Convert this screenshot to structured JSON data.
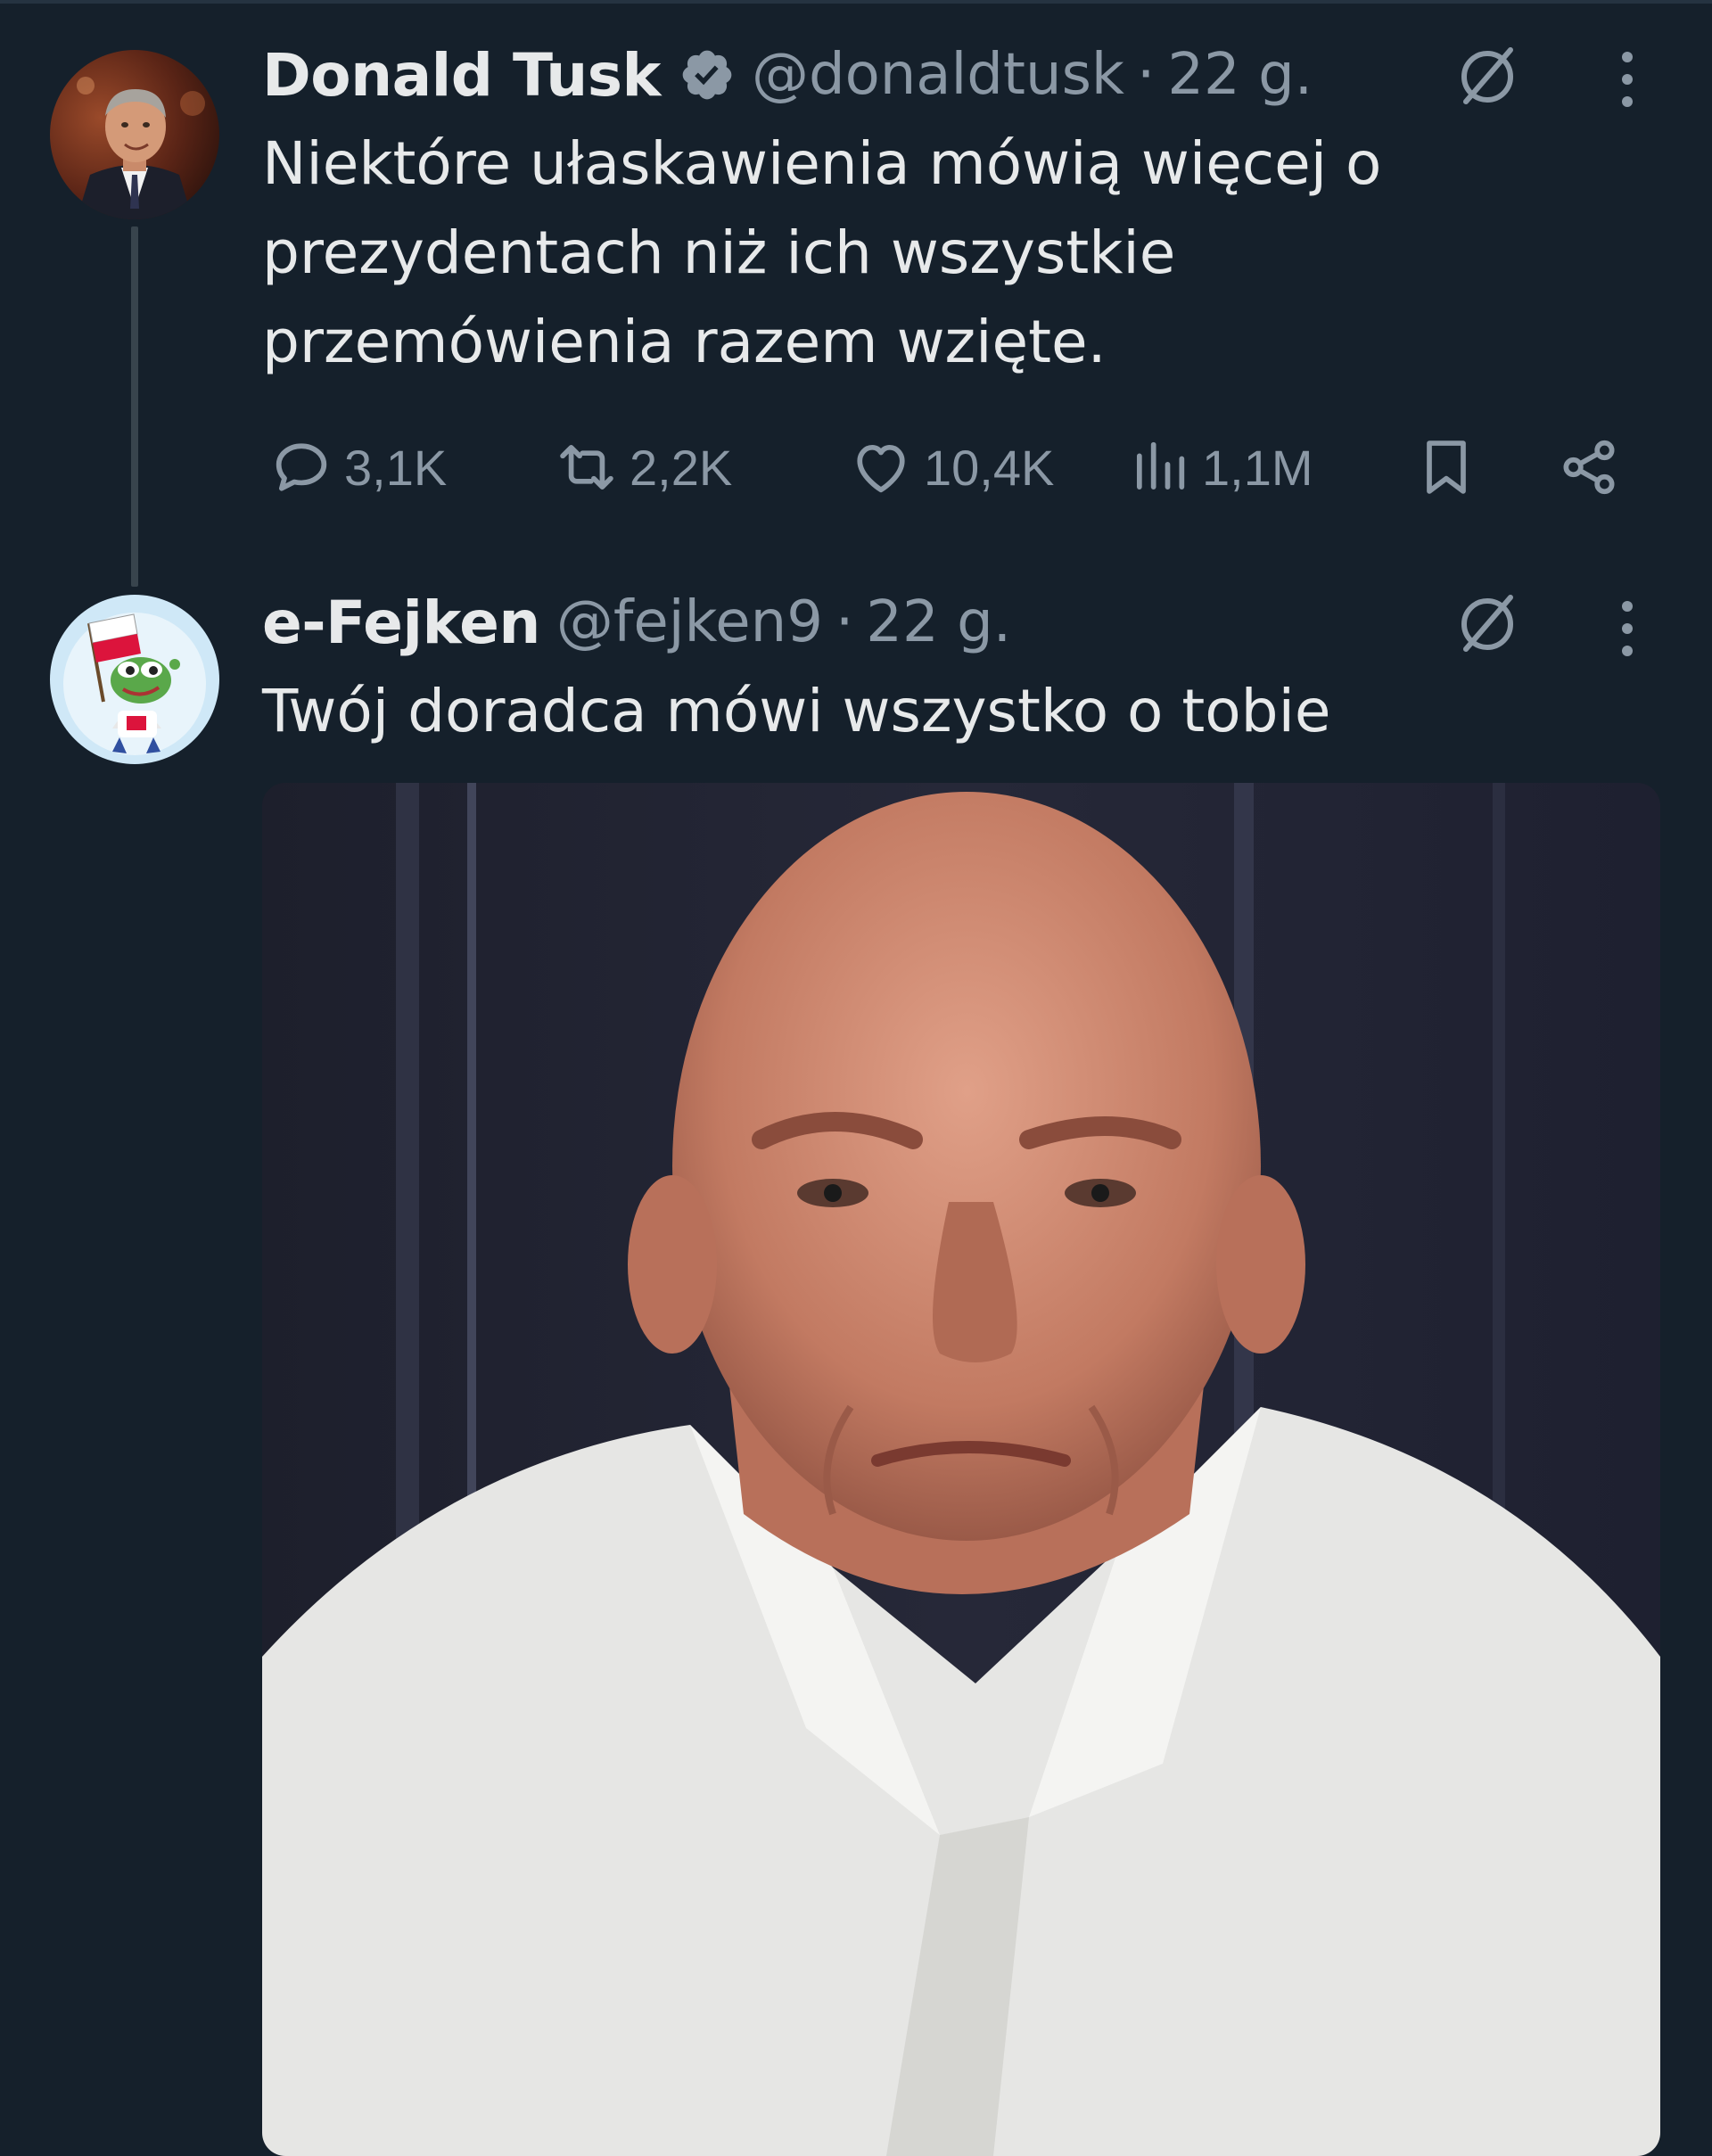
{
  "tweets": [
    {
      "display_name": "Donald Tusk",
      "verified": true,
      "handle": "@donaldtusk",
      "separator": "·",
      "time": "22 g.",
      "text_lines": [
        "Niektóre ułaskawienia mówią więcej o",
        "prezydentach niż ich wszystkie",
        "przemówienia razem wzięte."
      ],
      "actions": {
        "replies": "3,1K",
        "retweets": "2,2K",
        "likes": "10,4K",
        "views": "1,1M"
      },
      "icons": [
        "grok-icon",
        "more-icon",
        "reply-icon",
        "retweet-icon",
        "like-icon",
        "views-icon",
        "bookmark-icon",
        "share-icon"
      ]
    },
    {
      "display_name": "e-Fejken",
      "verified": false,
      "handle": "@fejken9",
      "separator": "·",
      "time": "22 g.",
      "text": "Twój doradca mówi wszystko o tobie",
      "icons": [
        "grok-icon",
        "more-icon"
      ]
    }
  ],
  "colors": {
    "background": "#15202b",
    "primary_text": "#e7e9ea",
    "secondary_text": "#8b98a5",
    "thread_line": "#38444d"
  }
}
